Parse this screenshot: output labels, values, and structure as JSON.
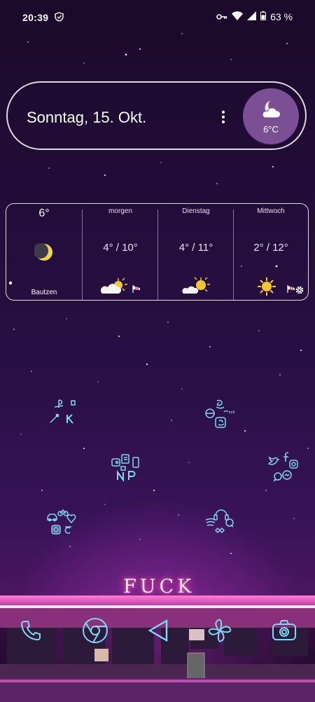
{
  "status_bar": {
    "time": "20:39",
    "battery_percent": "63 %",
    "icons": [
      "shield-icon",
      "vpn-key-icon",
      "wifi-icon",
      "signal-icon",
      "battery-icon"
    ]
  },
  "date_widget": {
    "date": "Sonntag, 15. Okt.",
    "temperature": "6°C",
    "condition_icon": "moon-cloud-icon",
    "badge_color": "#7a4f93"
  },
  "forecast": {
    "today": {
      "temp": "6°",
      "icon": "moon-icon",
      "location": "Bautzen"
    },
    "days": [
      {
        "name": "morgen",
        "range": "4° / 10°",
        "icon": "partly-cloudy-icon"
      },
      {
        "name": "Dienstag",
        "range": "4° / 11°",
        "icon": "partly-cloudy-icon"
      },
      {
        "name": "Mittwoch",
        "range": "2° / 12°",
        "icon": "sun-icon"
      }
    ]
  },
  "sign": {
    "text": "FUCK"
  },
  "dock": [
    "phone-icon",
    "chrome-icon",
    "back-icon",
    "pinwheel-icon",
    "camera-icon"
  ],
  "accent_color": "#7fd8f2"
}
